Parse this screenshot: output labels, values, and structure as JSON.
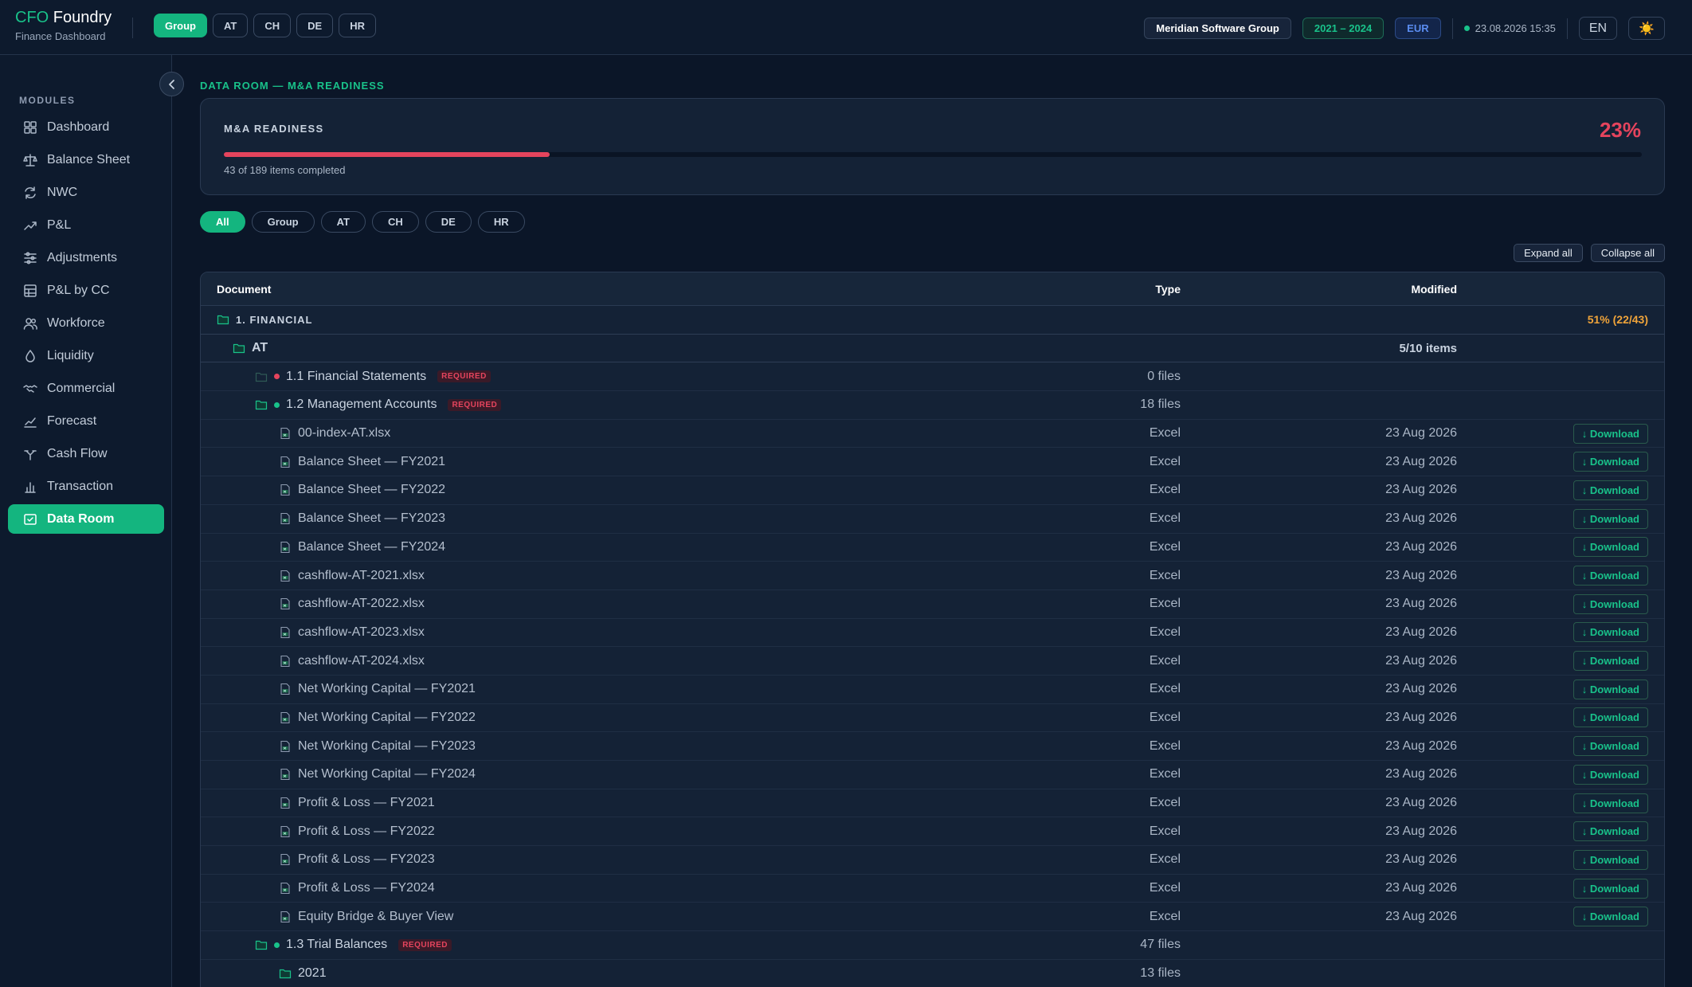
{
  "header": {
    "brand_accent": "CFO",
    "brand_rest": "Foundry",
    "brand_sub": "Finance Dashboard",
    "entity_tabs": [
      "Group",
      "AT",
      "CH",
      "DE",
      "HR"
    ],
    "company": "Meridian Software Group",
    "years": "2021 – 2024",
    "currency": "EUR",
    "timestamp": "23.08.2026 15:35",
    "language": "EN",
    "theme_icon": "☀️"
  },
  "sidebar": {
    "section_label": "MODULES",
    "items": [
      {
        "label": "Dashboard",
        "icon": "grid-icon"
      },
      {
        "label": "Balance Sheet",
        "icon": "scale-icon"
      },
      {
        "label": "NWC",
        "icon": "refresh-icon"
      },
      {
        "label": "P&L",
        "icon": "trend-up-icon"
      },
      {
        "label": "Adjustments",
        "icon": "sliders-icon"
      },
      {
        "label": "P&L by CC",
        "icon": "table-icon"
      },
      {
        "label": "Workforce",
        "icon": "users-icon"
      },
      {
        "label": "Liquidity",
        "icon": "droplet-icon"
      },
      {
        "label": "Commercial",
        "icon": "handshake-icon"
      },
      {
        "label": "Forecast",
        "icon": "chart-line-icon"
      },
      {
        "label": "Cash Flow",
        "icon": "split-icon"
      },
      {
        "label": "Transaction",
        "icon": "transaction-icon"
      },
      {
        "label": "Data Room",
        "icon": "folder-check-icon",
        "active": true
      }
    ]
  },
  "main": {
    "breadcrumb": "DATA ROOM — M&A READINESS",
    "readiness": {
      "title": "M&A READINESS",
      "percent_label": "23%",
      "progress": 0.23,
      "subtitle": "43 of 189 items completed"
    },
    "filters": [
      "All",
      "Group",
      "AT",
      "CH",
      "DE",
      "HR"
    ],
    "expand_all": "Expand all",
    "collapse_all": "Collapse all",
    "columns": {
      "document": "Document",
      "type": "Type",
      "modified": "Modified"
    },
    "download_label": "↓ Download",
    "required_label": "REQUIRED",
    "sections": [
      {
        "label": "1. FINANCIAL",
        "progress": "51% (22/43)",
        "entity": {
          "label": "AT",
          "count": "5/10 items"
        }
      }
    ],
    "rows": [
      {
        "kind": "folder",
        "name": "1.1 Financial Statements",
        "status": "red",
        "required": true,
        "count": "0 files",
        "empty": true
      },
      {
        "kind": "folder",
        "name": "1.2 Management Accounts",
        "status": "green",
        "required": true,
        "count": "18 files"
      },
      {
        "kind": "file",
        "name": "00-index-AT.xlsx",
        "type": "Excel",
        "modified": "23 Aug 2026"
      },
      {
        "kind": "file",
        "name": "Balance Sheet — FY2021",
        "type": "Excel",
        "modified": "23 Aug 2026"
      },
      {
        "kind": "file",
        "name": "Balance Sheet — FY2022",
        "type": "Excel",
        "modified": "23 Aug 2026"
      },
      {
        "kind": "file",
        "name": "Balance Sheet — FY2023",
        "type": "Excel",
        "modified": "23 Aug 2026"
      },
      {
        "kind": "file",
        "name": "Balance Sheet — FY2024",
        "type": "Excel",
        "modified": "23 Aug 2026"
      },
      {
        "kind": "file",
        "name": "cashflow-AT-2021.xlsx",
        "type": "Excel",
        "modified": "23 Aug 2026"
      },
      {
        "kind": "file",
        "name": "cashflow-AT-2022.xlsx",
        "type": "Excel",
        "modified": "23 Aug 2026"
      },
      {
        "kind": "file",
        "name": "cashflow-AT-2023.xlsx",
        "type": "Excel",
        "modified": "23 Aug 2026"
      },
      {
        "kind": "file",
        "name": "cashflow-AT-2024.xlsx",
        "type": "Excel",
        "modified": "23 Aug 2026"
      },
      {
        "kind": "file",
        "name": "Net Working Capital — FY2021",
        "type": "Excel",
        "modified": "23 Aug 2026"
      },
      {
        "kind": "file",
        "name": "Net Working Capital — FY2022",
        "type": "Excel",
        "modified": "23 Aug 2026"
      },
      {
        "kind": "file",
        "name": "Net Working Capital — FY2023",
        "type": "Excel",
        "modified": "23 Aug 2026"
      },
      {
        "kind": "file",
        "name": "Net Working Capital — FY2024",
        "type": "Excel",
        "modified": "23 Aug 2026"
      },
      {
        "kind": "file",
        "name": "Profit & Loss — FY2021",
        "type": "Excel",
        "modified": "23 Aug 2026"
      },
      {
        "kind": "file",
        "name": "Profit & Loss — FY2022",
        "type": "Excel",
        "modified": "23 Aug 2026"
      },
      {
        "kind": "file",
        "name": "Profit & Loss — FY2023",
        "type": "Excel",
        "modified": "23 Aug 2026"
      },
      {
        "kind": "file",
        "name": "Profit & Loss — FY2024",
        "type": "Excel",
        "modified": "23 Aug 2026"
      },
      {
        "kind": "file",
        "name": "Equity Bridge & Buyer View",
        "type": "Excel",
        "modified": "23 Aug 2026"
      },
      {
        "kind": "folder",
        "name": "1.3 Trial Balances",
        "status": "green",
        "required": true,
        "count": "47 files"
      },
      {
        "kind": "subfolder",
        "name": "2021",
        "count": "13 files"
      }
    ]
  }
}
